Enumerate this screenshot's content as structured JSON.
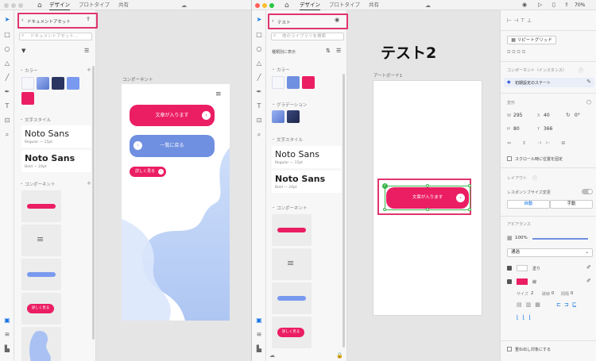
{
  "left_window": {
    "tabs": [
      "デザイン",
      "プロトタイプ",
      "共有"
    ],
    "panel_title": "ドキュメントアセット",
    "search_placeholder": "ドキュメントアセット...",
    "sections": {
      "colors": "カラー",
      "char_styles": "文字スタイル",
      "components": "コンポーネント"
    },
    "color_swatches": [
      "#f6f7fb",
      "#6f8fe0",
      "#2a3560",
      "#7a9af0",
      "#eb1e63"
    ],
    "font_styles": [
      {
        "name": "Noto Sans",
        "meta": "Regular — 15pt"
      },
      {
        "name": "Noto Sans",
        "meta": "Bold — 24pt"
      }
    ],
    "canvas_label": "コンポーネント",
    "buttons": {
      "primary": "文章が入ります",
      "back": "一覧に戻る",
      "more": "詳しく見る"
    }
  },
  "right_window": {
    "tabs": [
      "デザイン",
      "プロトタイプ",
      "共有"
    ],
    "zoom": "70%",
    "panel_title": "テスト",
    "search_placeholder": "他のライブラリを検索",
    "filter_label": "種類別に表示",
    "sections": {
      "colors": "カラー",
      "gradients": "グラデーション",
      "char_styles": "文字スタイル",
      "components": "コンポーネント"
    },
    "color_swatches": [
      "#f6f7fb",
      "#6f8fe0",
      "#eb1e63"
    ],
    "font_styles": [
      {
        "name": "Noto Sans",
        "meta": "Regular — 15pt"
      },
      {
        "name": "Noto Sans",
        "meta": "Bold — 24pt"
      }
    ],
    "canvas_title": "テスト2",
    "artboard_label": "アートボード1",
    "button_text": "文章が入ります",
    "inspector": {
      "repeat_grid": "リピートグリッド",
      "component_label": "コンポーネント（インスタンス）",
      "state_label": "初期設定のステート",
      "transform_label": "変形",
      "w_label": "W",
      "w": "295",
      "x_label": "X",
      "x": "40",
      "h_label": "H",
      "h": "80",
      "y_label": "Y",
      "y": "366",
      "rotation": "0°",
      "fix_scroll": "スクロール時に位置を固定",
      "layout_label": "レイアウト",
      "responsive": "レスポンシブサイズ変更",
      "auto": "自動",
      "manual": "手動",
      "appearance_label": "アピアランス",
      "opacity": "100%",
      "blend": "通過",
      "border_label": "線",
      "fill_label": "塗り",
      "fill_color": "#eb1e63",
      "size_label": "サイズ",
      "size_val": "2",
      "dash_label": "破線",
      "dash_val": "0",
      "gap_label": "間隔",
      "gap_val": "0",
      "overlap": "重ね出し対象にする"
    }
  },
  "colors": {
    "accent": "#eb1e63",
    "blue": "#6f8fe0",
    "highlight": "#e0356f"
  }
}
